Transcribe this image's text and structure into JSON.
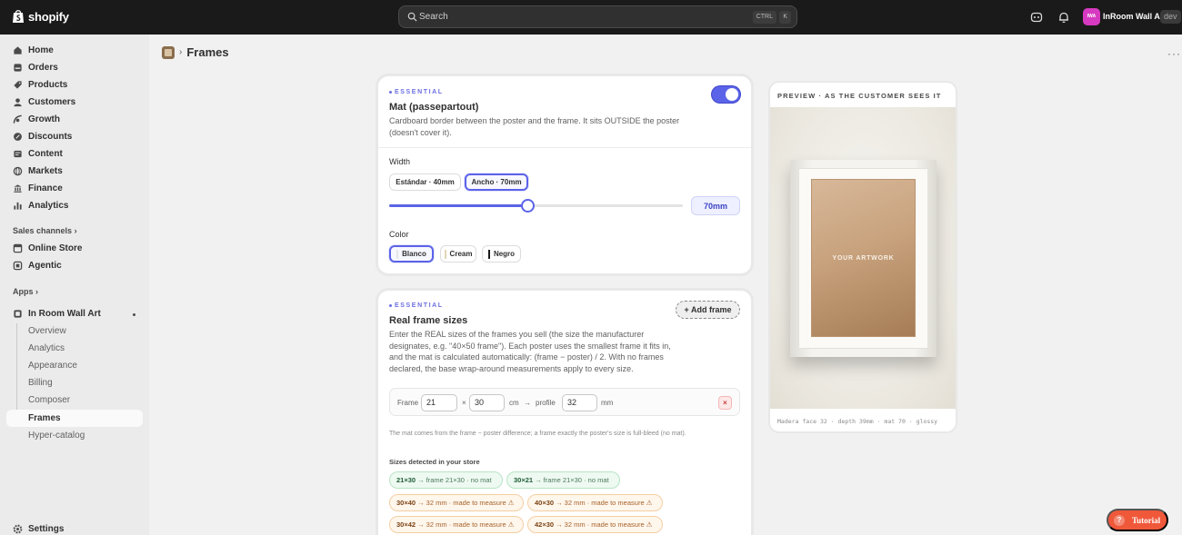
{
  "topbar": {
    "logo_text": "shopify",
    "search_placeholder": "Search",
    "kbd_ctrl": "CTRL",
    "kbd_k": "K",
    "store_initials": "IWA",
    "store_name": "InRoom Wall Art",
    "store_badge": "dev"
  },
  "sidebar": {
    "items": [
      {
        "label": "Home",
        "icon": "home-icon"
      },
      {
        "label": "Orders",
        "icon": "inbox-icon"
      },
      {
        "label": "Products",
        "icon": "tag-icon"
      },
      {
        "label": "Customers",
        "icon": "person-icon"
      },
      {
        "label": "Growth",
        "icon": "growth-icon"
      },
      {
        "label": "Discounts",
        "icon": "discount-icon"
      },
      {
        "label": "Content",
        "icon": "content-icon"
      },
      {
        "label": "Markets",
        "icon": "globe-icon"
      },
      {
        "label": "Finance",
        "icon": "bank-icon"
      },
      {
        "label": "Analytics",
        "icon": "chart-icon"
      }
    ],
    "sales_channels_title": "Sales channels",
    "channels": [
      {
        "label": "Online Store",
        "icon": "store-icon"
      },
      {
        "label": "Agentic",
        "icon": "agent-icon"
      }
    ],
    "apps_title": "Apps",
    "app": {
      "label": "In Room Wall Art",
      "icon": "app-icon"
    },
    "app_subitems": [
      "Overview",
      "Analytics",
      "Appearance",
      "Billing",
      "Composer",
      "Frames",
      "Hyper-catalog"
    ],
    "settings_label": "Settings"
  },
  "header": {
    "page_title": "Frames",
    "separator": "›",
    "more": "···"
  },
  "mat_card": {
    "essential_label": "ESSENTIAL",
    "title": "Mat (passepartout)",
    "description": "Cardboard border between the poster and the frame. It sits OUTSIDE the poster (doesn't cover it).",
    "enabled": true,
    "width_label": "Width",
    "width_options": [
      "Estándar · 40mm",
      "Ancho · 70mm"
    ],
    "width_selected": "Ancho · 70mm",
    "slider_fraction": 0.47,
    "width_value": "70mm",
    "color_label": "Color",
    "color_options": [
      {
        "label": "Blanco",
        "swatch": "#f3f3f3"
      },
      {
        "label": "Cream",
        "swatch": "#efe5cf"
      },
      {
        "label": "Negro",
        "swatch": "#1a1a1a"
      }
    ],
    "color_selected": "Blanco"
  },
  "frames_card": {
    "essential_label": "ESSENTIAL",
    "title": "Real frame sizes",
    "add_button": "+ Add frame",
    "description": "Enter the REAL sizes of the frames you sell (the size the manufacturer designates, e.g. \"40×50 frame\"). Each poster uses the smallest frame it fits in, and the mat is calculated automatically: (frame − poster) / 2. With no frames declared, the base wrap-around measurements apply to every size.",
    "frame_row": {
      "frame_label": "Frame",
      "width": "21",
      "times": "×",
      "height": "30",
      "unit": "cm",
      "arrow": "→",
      "profile_label": "profile",
      "profile": "32",
      "profile_unit": "mm",
      "remove": "×"
    },
    "note": "The mat comes from the frame − poster difference; a frame exactly the poster's size is full-bleed (no mat).",
    "sizes_title": "Sizes detected in your store",
    "sizes": [
      {
        "size": "21×30",
        "detail": "→ frame 21×30 · no mat",
        "status": "green"
      },
      {
        "size": "30×21",
        "detail": "→ frame 21×30 · no mat",
        "status": "green"
      },
      {
        "size": "30×40",
        "detail": "→ 32 mm · made to measure ⚠",
        "status": "orange"
      },
      {
        "size": "40×30",
        "detail": "→ 32 mm · made to measure ⚠",
        "status": "orange"
      },
      {
        "size": "30×42",
        "detail": "→ 32 mm · made to measure ⚠",
        "status": "orange"
      },
      {
        "size": "42×30",
        "detail": "→ 32 mm · made to measure ⚠",
        "status": "orange"
      }
    ]
  },
  "preview": {
    "title": "PREVIEW · AS THE CUSTOMER SEES IT",
    "art_label": "YOUR ARTWORK",
    "footer": "Madera  face 32 · depth 39mm · mat 70 · glossy"
  },
  "tutorial": {
    "icon": "?",
    "label": "Tutorial"
  },
  "colors": {
    "accent": "#5b63e8",
    "topbar": "#1a1a1a",
    "tutorial": "#f0583a"
  }
}
